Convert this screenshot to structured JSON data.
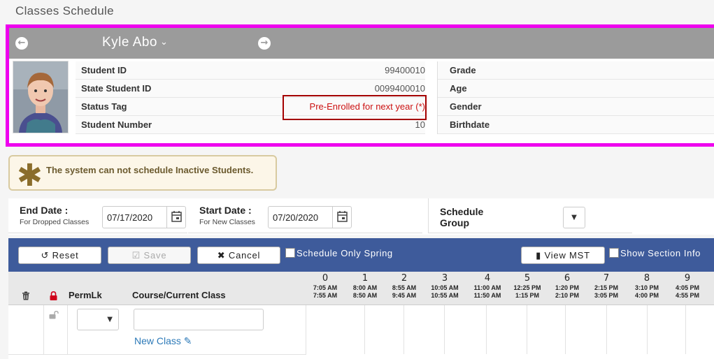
{
  "page": {
    "title": "Classes Schedule"
  },
  "student": {
    "name": "Kyle Abo",
    "left_fields": [
      {
        "label": "Student ID",
        "value": "99400010"
      },
      {
        "label": "State Student ID",
        "value": "0099400010"
      },
      {
        "label": "Status Tag",
        "value": "Pre-Enrolled for next year (*)"
      },
      {
        "label": "Student Number",
        "value": "10"
      }
    ],
    "right_fields": [
      {
        "label": "Grade",
        "value": ""
      },
      {
        "label": "Age",
        "value": ""
      },
      {
        "label": "Gender",
        "value": ""
      },
      {
        "label": "Birthdate",
        "value": ""
      }
    ]
  },
  "alert": {
    "message": "The system can not schedule Inactive Students."
  },
  "dates": {
    "end": {
      "label": "End Date :",
      "sub": "For Dropped Classes",
      "value": "07/17/2020"
    },
    "start": {
      "label": "Start Date :",
      "sub": "For New Classes",
      "value": "07/20/2020"
    },
    "schedule_group_line1": "Schedule",
    "schedule_group_line2": "Group"
  },
  "toolbar": {
    "reset": "Reset",
    "save": "Save",
    "cancel": "Cancel",
    "schedule_only_spring": "Schedule Only Spring",
    "view_mst": "View MST",
    "show_section_info": "Show Section Info"
  },
  "schedule": {
    "col_permlk": "PermLk",
    "col_course": "Course/Current Class",
    "new_class": "New Class",
    "periods": [
      {
        "num": "0",
        "start": "7:05 AM",
        "end": "7:55 AM"
      },
      {
        "num": "1",
        "start": "8:00 AM",
        "end": "8:50 AM"
      },
      {
        "num": "2",
        "start": "8:55 AM",
        "end": "9:45 AM"
      },
      {
        "num": "3",
        "start": "10:05 AM",
        "end": "10:55 AM"
      },
      {
        "num": "4",
        "start": "11:00 AM",
        "end": "11:50 AM"
      },
      {
        "num": "5",
        "start": "12:25 PM",
        "end": "1:15 PM"
      },
      {
        "num": "6",
        "start": "1:20 PM",
        "end": "2:10 PM"
      },
      {
        "num": "7",
        "start": "2:15 PM",
        "end": "3:05 PM"
      },
      {
        "num": "8",
        "start": "3:10 PM",
        "end": "4:00 PM"
      },
      {
        "num": "9",
        "start": "4:05 PM",
        "end": "4:55 PM"
      }
    ]
  },
  "colors": {
    "highlight_border": "#ee00ee",
    "status_box": "#a40000",
    "toolbar_bg": "#3e5b9b",
    "link": "#2d7ab8"
  }
}
